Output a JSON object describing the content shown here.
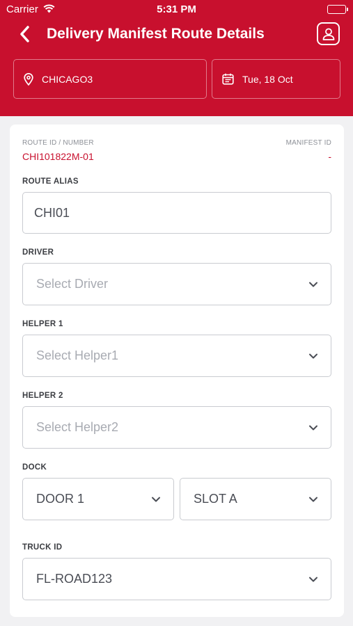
{
  "status_bar": {
    "carrier": "Carrier",
    "time": "5:31 PM"
  },
  "header": {
    "title": "Delivery Manifest Route Details",
    "location": "CHICAGO3",
    "date": "Tue, 18 Oct"
  },
  "route": {
    "route_id_label": "ROUTE ID / NUMBER",
    "route_id_value": "CHI101822M-01",
    "manifest_id_label": "MANIFEST ID",
    "manifest_id_value": "-"
  },
  "form": {
    "route_alias_label": "ROUTE ALIAS",
    "route_alias_value": "CHI01",
    "driver_label": "DRIVER",
    "driver_placeholder": "Select Driver",
    "helper1_label": "HELPER 1",
    "helper1_placeholder": "Select Helper1",
    "helper2_label": "HELPER 2",
    "helper2_placeholder": "Select Helper2",
    "dock_label": "DOCK",
    "dock_door_value": "DOOR 1",
    "dock_slot_value": "SLOT A",
    "truck_label": "TRUCK ID",
    "truck_value": "FL-ROAD123"
  },
  "colors": {
    "brand": "#c8102e",
    "background": "#f1f1f3"
  },
  "icons": [
    "back-chevron-icon",
    "user-profile-icon",
    "location-pin-icon",
    "calendar-icon",
    "chevron-down-icon",
    "wifi-icon",
    "battery-icon"
  ]
}
